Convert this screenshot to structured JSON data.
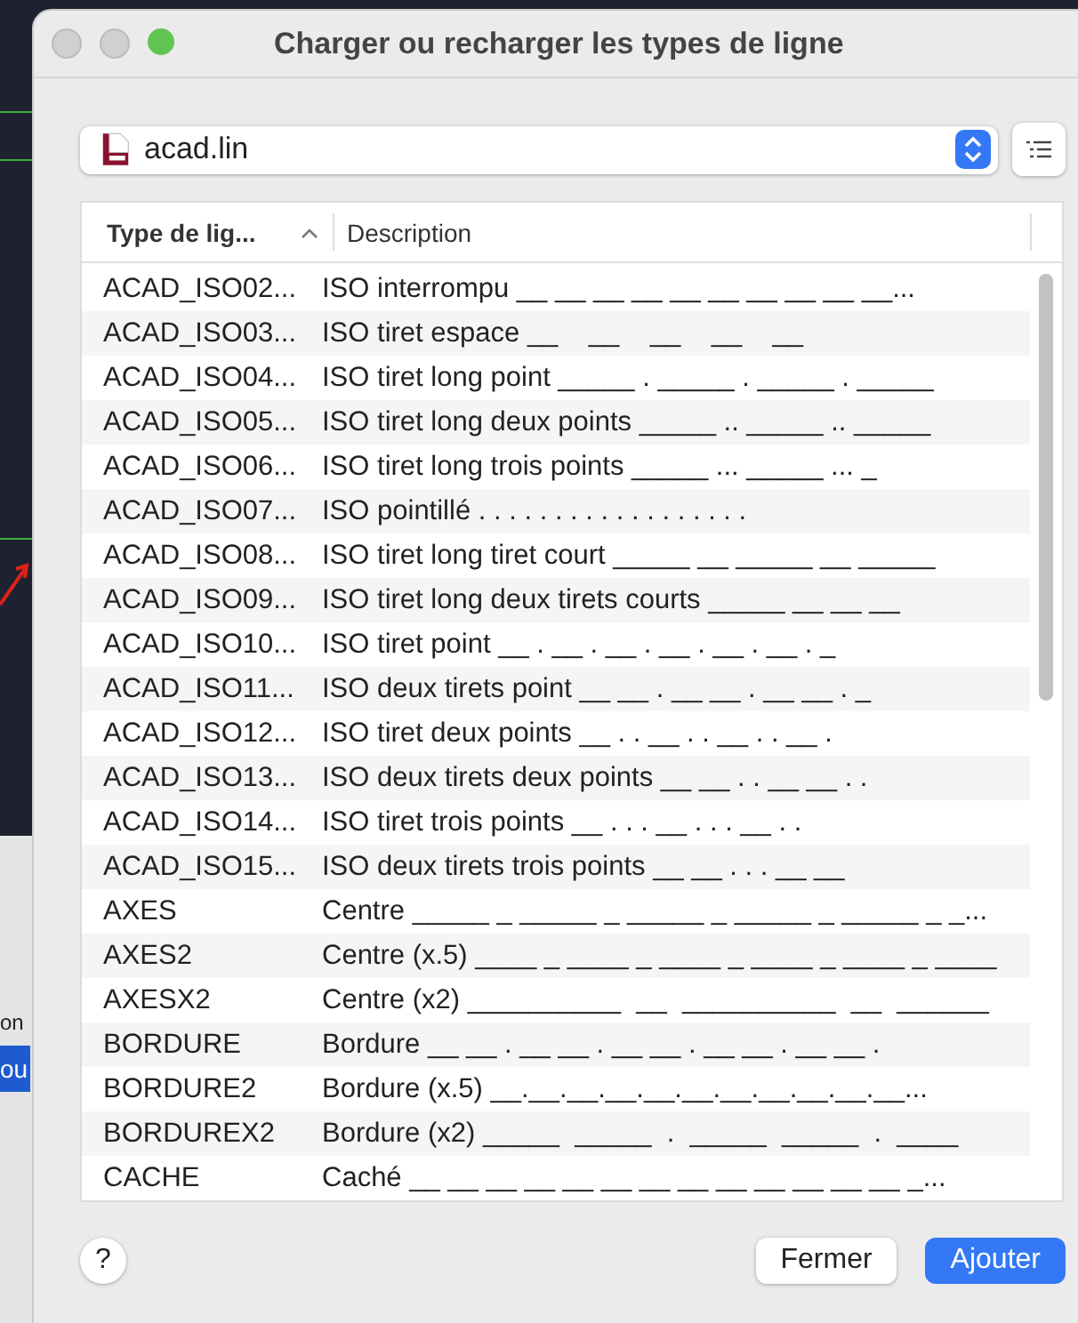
{
  "background_app": {
    "rows": [
      {
        "text": "on",
        "selected": false
      },
      {
        "text": "ou",
        "selected": true
      }
    ]
  },
  "window": {
    "title": "Charger ou recharger les types de ligne"
  },
  "file_popup": {
    "value": "acad.lin"
  },
  "table": {
    "columns": [
      {
        "label": "Type de lig...",
        "sorted": true
      },
      {
        "label": "Description",
        "sorted": false
      }
    ],
    "rows": [
      {
        "name": "ACAD_ISO02...",
        "description": "ISO interrompu __ __ __ __ __ __ __ __ __ __..."
      },
      {
        "name": "ACAD_ISO03...",
        "description": "ISO tiret espace __    __    __    __    __"
      },
      {
        "name": "ACAD_ISO04...",
        "description": "ISO tiret long point _____ . _____ . _____ . _____"
      },
      {
        "name": "ACAD_ISO05...",
        "description": "ISO tiret long deux points _____ .. _____ .. _____"
      },
      {
        "name": "ACAD_ISO06...",
        "description": "ISO tiret long trois points _____ ... _____ ... _"
      },
      {
        "name": "ACAD_ISO07...",
        "description": "ISO pointillé . . . . . . . . . . . . . . . . . ."
      },
      {
        "name": "ACAD_ISO08...",
        "description": "ISO tiret long tiret court _____ __ _____ __ _____"
      },
      {
        "name": "ACAD_ISO09...",
        "description": "ISO tiret long deux tirets courts _____ __ __ __"
      },
      {
        "name": "ACAD_ISO10...",
        "description": "ISO tiret point __ . __ . __ . __ . __ . __ . _"
      },
      {
        "name": "ACAD_ISO11...",
        "description": "ISO deux tirets point __ __ . __ __ . __ __ . _"
      },
      {
        "name": "ACAD_ISO12...",
        "description": "ISO tiret deux points __ . . __ . . __ . . __ ."
      },
      {
        "name": "ACAD_ISO13...",
        "description": "ISO deux tirets deux points __ __ . . __ __ . ."
      },
      {
        "name": "ACAD_ISO14...",
        "description": "ISO tiret trois points __ . . . __ . . . __ . ."
      },
      {
        "name": "ACAD_ISO15...",
        "description": "ISO deux tirets trois points __ __ . . . __ __"
      },
      {
        "name": "AXES",
        "description": "Centre _____ _ _____ _ _____ _ _____ _ _____ _ _..."
      },
      {
        "name": "AXES2",
        "description": "Centre (x.5) ____ _ ____ _ ____ _ ____ _ ____ _ ____"
      },
      {
        "name": "AXESX2",
        "description": "Centre (x2) __________  __  __________  __  ______"
      },
      {
        "name": "BORDURE",
        "description": "Bordure __ __ . __ __ . __ __ . __ __ . __ __ ."
      },
      {
        "name": "BORDURE2",
        "description": "Bordure (x.5) __.__.__.__.__.__.__.__.__.__.__..."
      },
      {
        "name": "BORDUREX2",
        "description": "Bordure (x2) _____  _____  .  _____  _____  .  ____"
      },
      {
        "name": "CACHE",
        "description": "Caché __ __ __ __ __ __ __ __ __ __ __ __ __ _..."
      }
    ]
  },
  "buttons": [
    {
      "kind": "help",
      "label": "?"
    },
    {
      "kind": "secondary",
      "label": "Fermer"
    },
    {
      "kind": "primary",
      "label": "Ajouter"
    }
  ]
}
